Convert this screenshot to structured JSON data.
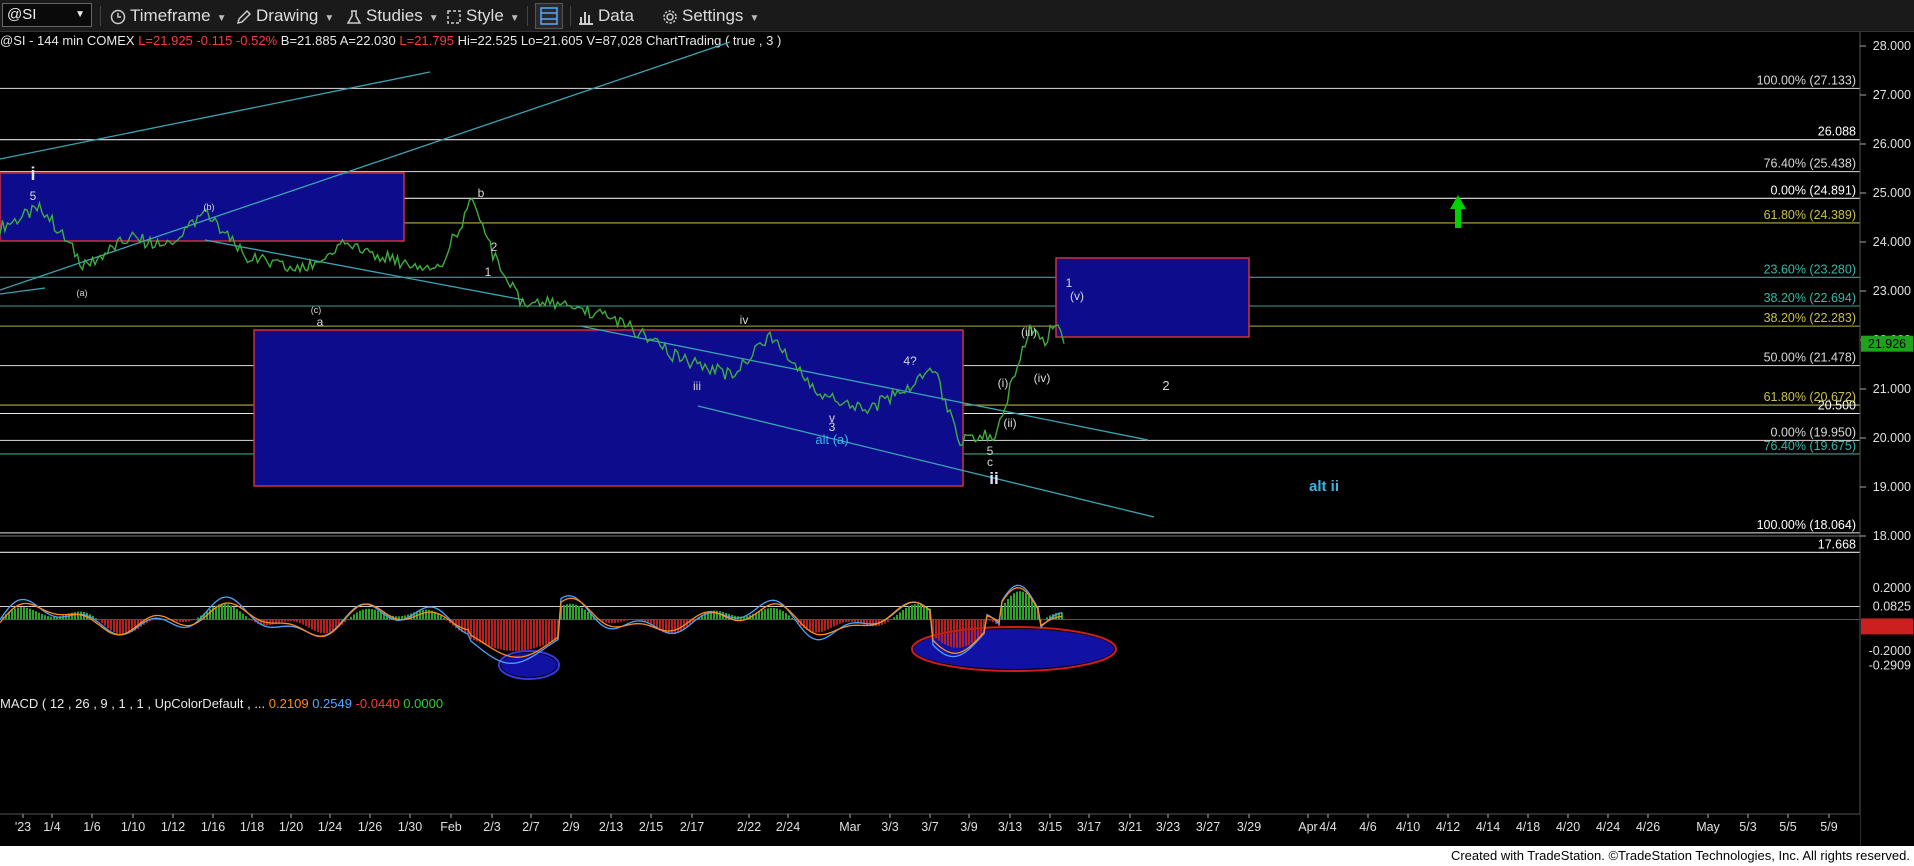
{
  "toolbar": {
    "symbol": "@SI",
    "timeframe": "Timeframe",
    "drawing": "Drawing",
    "studies": "Studies",
    "style": "Style",
    "data": "Data",
    "settings": "Settings"
  },
  "status": {
    "symbol": "@SI - 144 min",
    "exchange": "COMEX",
    "last": "L=21.925",
    "change": "-0.115",
    "change_pct": "-0.52%",
    "bid": "B=21.885",
    "ask": "A=22.030",
    "last_trade": "L=21.795",
    "high": "Hi=22.525",
    "low": "Lo=21.605",
    "volume": "V=87,028",
    "study": "ChartTrading ( true , 3 )"
  },
  "macd_status": {
    "label": "MACD ( 12 , 26 , 9 , 1 , 1 , UpColorDefault , ...",
    "macd": "0.2109",
    "signal": "0.2549",
    "diff": "-0.0440",
    "zero": "0.0000"
  },
  "footer": "Created with TradeStation. ©TradeStation Technologies, Inc. All rights reserved.",
  "colors": {
    "background": "#000000",
    "price": "#3fae3f",
    "box_fill": "#0c0c8c",
    "box_border": "#d0303a",
    "trend": "#3aa4b4",
    "macd": "#4aa3ff",
    "signal": "#ff8c1a",
    "label_blue": "#39b6e6"
  },
  "chart_data": [
    {
      "type": "line",
      "series": [
        {
          "name": "@SI",
          "x": [
            "12/29",
            "1/3",
            "1/6",
            "1/10",
            "1/13",
            "1/16",
            "1/19",
            "1/23",
            "1/26",
            "1/30",
            "2/1",
            "2/2",
            "2/3",
            "2/6",
            "2/9",
            "2/13",
            "2/16",
            "2/20",
            "2/23",
            "2/24",
            "2/28",
            "3/2",
            "3/6",
            "3/7",
            "3/8",
            "3/9",
            "3/10",
            "3/13",
            "3/14",
            "3/15",
            "3/16",
            "3/17"
          ],
          "values": [
            24.3,
            24.7,
            23.5,
            24.1,
            23.9,
            24.6,
            23.7,
            23.4,
            24.0,
            23.6,
            23.5,
            24.85,
            23.5,
            22.8,
            22.7,
            22.4,
            21.6,
            21.3,
            22.1,
            20.9,
            20.6,
            21.0,
            21.4,
            20.7,
            19.95,
            20.0,
            20.1,
            21.3,
            22.3,
            22.0,
            22.4,
            21.925
          ]
        }
      ],
      "x_ticks": [
        "'23",
        "1/4",
        "1/6",
        "1/10",
        "1/12",
        "1/16",
        "1/18",
        "1/20",
        "1/24",
        "1/26",
        "1/30",
        "Feb",
        "2/3",
        "2/7",
        "2/9",
        "2/13",
        "2/15",
        "2/17",
        "2/22",
        "2/24",
        "Mar",
        "3/3",
        "3/7",
        "3/9",
        "3/13",
        "3/15",
        "3/17",
        "3/21",
        "3/23",
        "3/27",
        "3/29",
        "Apr",
        "4/4",
        "4/6",
        "4/10",
        "4/12",
        "4/14",
        "4/18",
        "4/20",
        "4/24",
        "4/26",
        "May",
        "5/3",
        "5/5",
        "5/9"
      ],
      "y_ticks": [
        "28.000",
        "27.000",
        "26.000",
        "25.000",
        "24.000",
        "23.000",
        "22.000",
        "21.000",
        "20.000",
        "19.000",
        "18.000"
      ],
      "ylim": [
        17.0,
        28.0
      ],
      "last_price": "21.926",
      "levels": [
        {
          "label": "100.00% (27.133)",
          "value": 27.133,
          "color": "#d8d8d8"
        },
        {
          "label": "26.088",
          "value": 26.088,
          "color": "#ffffff"
        },
        {
          "label": "76.40% (25.438)",
          "value": 25.438,
          "color": "#d8d8d8"
        },
        {
          "label": "0.00% (24.891)",
          "value": 24.891,
          "color": "#ffffff"
        },
        {
          "label": "61.80% (24.389)",
          "value": 24.389,
          "color": "#c9c24a"
        },
        {
          "label": "23.60% (23.280)",
          "value": 23.28,
          "color": "#36b8a8"
        },
        {
          "label": "38.20% (22.694)",
          "value": 22.694,
          "color": "#36b8a8"
        },
        {
          "label": "38.20% (22.283)",
          "value": 22.283,
          "color": "#c9c24a"
        },
        {
          "label": "50.00% (21.478)",
          "value": 21.478,
          "color": "#d8d8d8"
        },
        {
          "label": "61.80% (20.672)",
          "value": 20.672,
          "color": "#c9c24a"
        },
        {
          "label": "20.500",
          "value": 20.5,
          "color": "#ffffff"
        },
        {
          "label": "0.00% (19.950)",
          "value": 19.95,
          "color": "#d8d8d8"
        },
        {
          "label": "76.40% (19.675)",
          "value": 19.675,
          "color": "#36b8a8"
        },
        {
          "label": "100.00% (18.064)",
          "value": 18.064,
          "color": "#ffffff"
        },
        {
          "label": "17.668",
          "value": 17.668,
          "color": "#ffffff"
        }
      ],
      "wave_labels": [
        "i",
        "5",
        "b",
        "(b)",
        "(a)",
        "(c)",
        "a",
        "2",
        "1",
        "iv",
        "iii",
        "4?",
        "v",
        "3",
        "alt (a)",
        "5",
        "c",
        "ii",
        "(i)",
        "(ii)",
        "(iii)",
        "(iv)",
        "1",
        "(v)",
        "2",
        "alt ii"
      ]
    },
    {
      "type": "bar",
      "title": "MACD ( 12 , 26 , 9 , 1 , 1 , UpColorDefault , ...",
      "y_ticks": [
        "0.2000",
        "0.0825",
        "-0.2000",
        "-0.2909"
      ],
      "last_values": [
        "0.2109",
        "0.2549",
        "-0.0440",
        "0.0000"
      ],
      "ylim": [
        -0.31,
        0.26
      ]
    }
  ]
}
